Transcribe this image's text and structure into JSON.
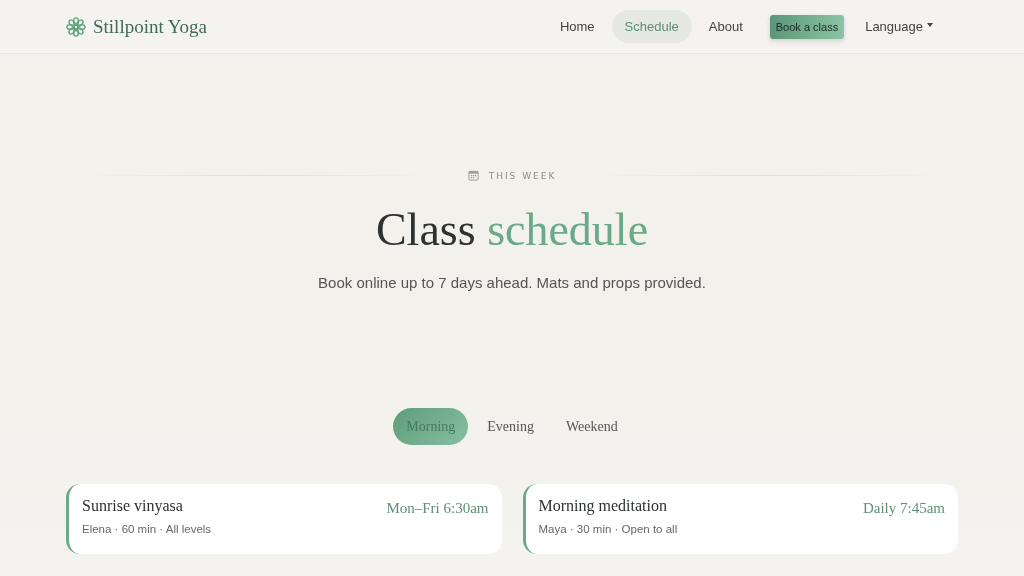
{
  "brand": {
    "name": "Stillpoint Yoga"
  },
  "nav": [
    {
      "label": "Home",
      "kind": "link",
      "selected": false
    },
    {
      "label": "Schedule",
      "kind": "link",
      "selected": true
    },
    {
      "label": "About",
      "kind": "link",
      "selected": false
    },
    {
      "label": "Book a class",
      "kind": "cta",
      "selected": false
    },
    {
      "label": "Language",
      "kind": "dropdown",
      "selected": false
    }
  ],
  "hero": {
    "eyebrow": "THIS WEEK",
    "title": "Class",
    "title_accent": "schedule",
    "subtitle": "Book online up to 7 days ahead. Mats and props provided."
  },
  "tabs": [
    {
      "label": "Morning",
      "selected": true
    },
    {
      "label": "Evening",
      "selected": false
    },
    {
      "label": "Weekend",
      "selected": false
    }
  ],
  "classes": [
    {
      "name": "Sunrise vinyasa",
      "details": "Elena · 60 min · All levels",
      "time": "Mon–Fri 6:30am"
    },
    {
      "name": "Morning meditation",
      "details": "Maya · 30 min · Open to all",
      "time": "Daily 7:45am"
    }
  ]
}
